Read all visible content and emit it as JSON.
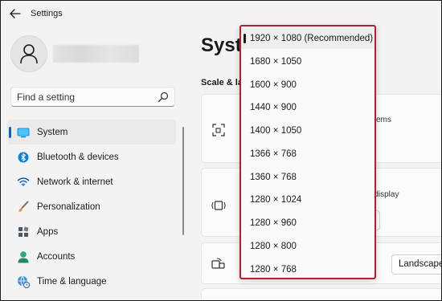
{
  "window": {
    "title": "Settings"
  },
  "search": {
    "placeholder": "Find a setting"
  },
  "sidebar": {
    "items": [
      {
        "label": "System",
        "icon": "system-icon",
        "active": true
      },
      {
        "label": "Bluetooth & devices",
        "icon": "bluetooth-icon"
      },
      {
        "label": "Network & internet",
        "icon": "wifi-icon"
      },
      {
        "label": "Personalization",
        "icon": "brush-icon"
      },
      {
        "label": "Apps",
        "icon": "apps-icon"
      },
      {
        "label": "Accounts",
        "icon": "accounts-icon"
      },
      {
        "label": "Time & language",
        "icon": "globe-clock-icon"
      }
    ]
  },
  "main": {
    "title_partial": "Syste",
    "section_partial": "Scale & la",
    "card1_partial": "ems",
    "card2_partial": "d display",
    "orientation_value": "Landscape"
  },
  "resolution_dropdown": {
    "options": [
      "1920 × 1080 (Recommended)",
      "1680 × 1050",
      "1600 × 900",
      "1440 × 900",
      "1400 × 1050",
      "1366 × 768",
      "1360 × 768",
      "1280 × 1024",
      "1280 × 960",
      "1280 × 800",
      "1280 × 768"
    ],
    "selected_index": 0
  },
  "colors": {
    "accent": "#0067c0",
    "highlight_border": "#b3202e"
  }
}
